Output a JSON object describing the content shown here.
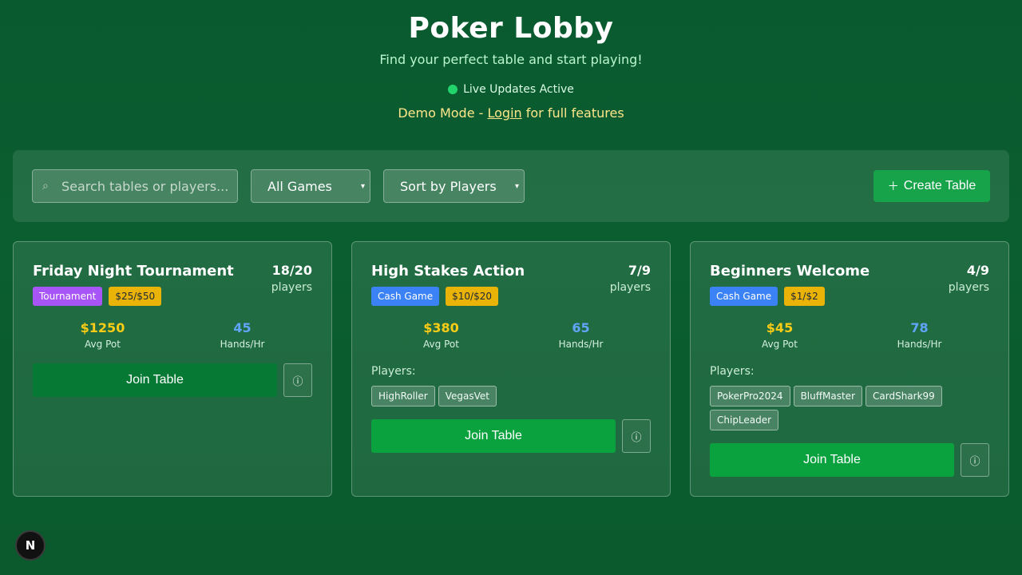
{
  "header": {
    "title": "Poker Lobby",
    "subtitle": "Find your perfect table and start playing!",
    "live_status": "Live Updates Active",
    "demo_prefix": "Demo Mode - ",
    "demo_link": "Login",
    "demo_suffix": " for full features"
  },
  "toolbar": {
    "search_placeholder": "Search tables or players...",
    "search_value": "",
    "game_filter": "All Games",
    "sort_filter": "Sort by Players",
    "create_label": "Create Table"
  },
  "icons": {
    "search": "search-icon",
    "plus": "plus-icon",
    "info": "info-icon",
    "chevron": "chevron-down-icon"
  },
  "colors": {
    "live": "#22d36b",
    "tournament": "#a855f7",
    "cash": "#3b82f6",
    "stakes": "#eab308",
    "avg_pot": "#facc15",
    "hands": "#60a5fa",
    "primary_button": "#16a34a"
  },
  "tables": [
    {
      "name": "Friday Night Tournament",
      "seats": "18/20",
      "seats_label": "players",
      "type": "Tournament",
      "stakes": "$25/$50",
      "avg_pot": "$1250",
      "avg_pot_label": "Avg Pot",
      "hands_hr": "45",
      "hands_hr_label": "Hands/Hr",
      "players_label": "",
      "players": [],
      "join_label": "Join Table"
    },
    {
      "name": "High Stakes Action",
      "seats": "7/9",
      "seats_label": "players",
      "type": "Cash Game",
      "stakes": "$10/$20",
      "avg_pot": "$380",
      "avg_pot_label": "Avg Pot",
      "hands_hr": "65",
      "hands_hr_label": "Hands/Hr",
      "players_label": "Players:",
      "players": [
        "HighRoller",
        "VegasVet"
      ],
      "join_label": "Join Table"
    },
    {
      "name": "Beginners Welcome",
      "seats": "4/9",
      "seats_label": "players",
      "type": "Cash Game",
      "stakes": "$1/$2",
      "avg_pot": "$45",
      "avg_pot_label": "Avg Pot",
      "hands_hr": "78",
      "hands_hr_label": "Hands/Hr",
      "players_label": "Players:",
      "players": [
        "PokerPro2024",
        "BluffMaster",
        "CardShark99",
        "ChipLeader"
      ],
      "join_label": "Join Table"
    }
  ],
  "fab": {
    "label": "N"
  }
}
